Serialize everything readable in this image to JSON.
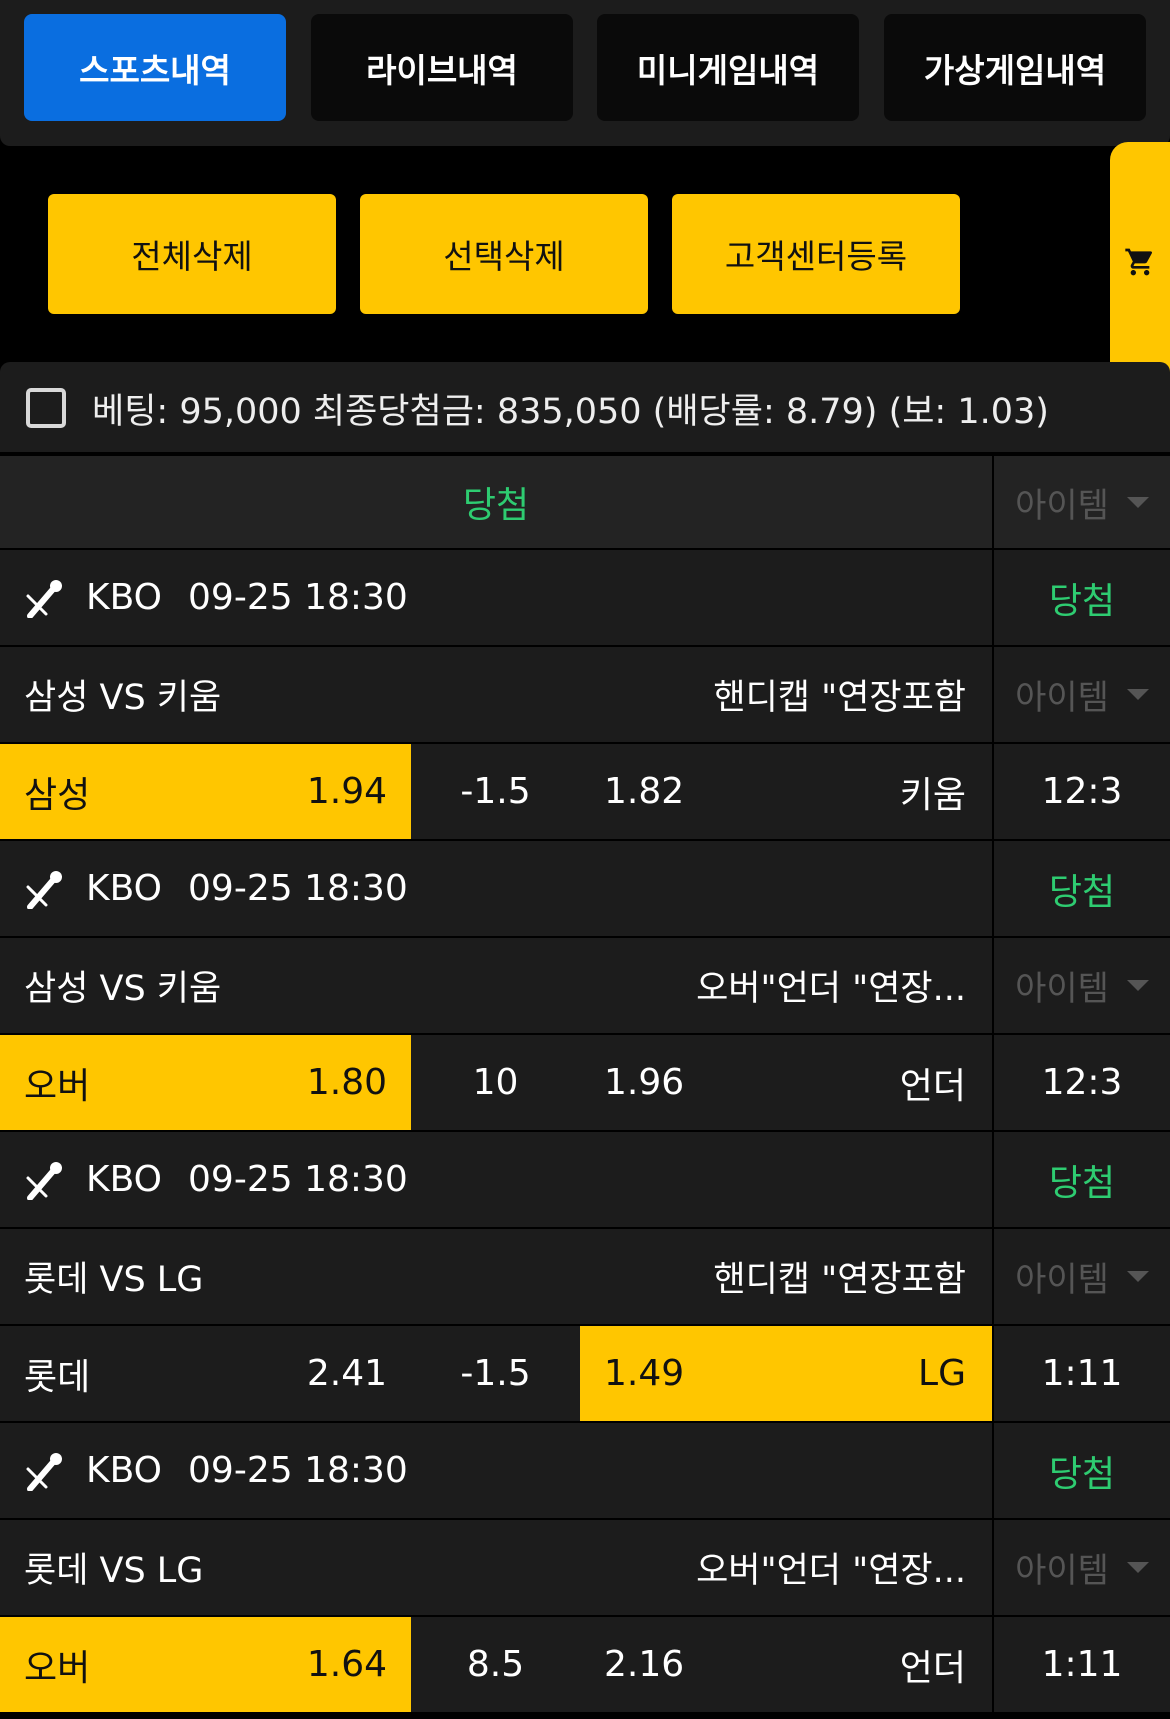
{
  "tabs": [
    {
      "label": "스포츠내역",
      "active": true
    },
    {
      "label": "라이브내역",
      "active": false
    },
    {
      "label": "미니게임내역",
      "active": false
    },
    {
      "label": "가상게임내역",
      "active": false
    }
  ],
  "actions": {
    "delete_all": "전체삭제",
    "delete_selected": "선택삭제",
    "register_support": "고객센터등록"
  },
  "cart_icon": "cart-icon",
  "summary": {
    "text": "베팅: 95,000 최종당첨금: 835,050 (배당률: 8.79) (보: 1.03)"
  },
  "header": {
    "result": "당첨",
    "item_label": "아이템"
  },
  "colors": {
    "accent_blue": "#0a6ee0",
    "accent_yellow": "#ffc600",
    "win_green": "#2ecc71"
  },
  "bets": [
    {
      "sport_icon": "baseball-icon",
      "league": "KBO",
      "datetime": "09-25 18:30",
      "result": "당첨",
      "match": "삼성 VS 키움",
      "bet_type": "핸디캡 \"연장포함",
      "item_label": "아이템",
      "home": "삼성",
      "home_odds": "1.94",
      "line": "-1.5",
      "away_odds": "1.82",
      "away": "키움",
      "selected": "home",
      "score": "12:3"
    },
    {
      "sport_icon": "baseball-icon",
      "league": "KBO",
      "datetime": "09-25 18:30",
      "result": "당첨",
      "match": "삼성 VS 키움",
      "bet_type": "오버\"언더 \"연장...",
      "item_label": "아이템",
      "home": "오버",
      "home_odds": "1.80",
      "line": "10",
      "away_odds": "1.96",
      "away": "언더",
      "selected": "home",
      "score": "12:3"
    },
    {
      "sport_icon": "baseball-icon",
      "league": "KBO",
      "datetime": "09-25 18:30",
      "result": "당첨",
      "match": "롯데 VS LG",
      "bet_type": "핸디캡 \"연장포함",
      "item_label": "아이템",
      "home": "롯데",
      "home_odds": "2.41",
      "line": "-1.5",
      "away_odds": "1.49",
      "away": "LG",
      "selected": "away",
      "score": "1:11"
    },
    {
      "sport_icon": "baseball-icon",
      "league": "KBO",
      "datetime": "09-25 18:30",
      "result": "당첨",
      "match": "롯데 VS LG",
      "bet_type": "오버\"언더 \"연장...",
      "item_label": "아이템",
      "home": "오버",
      "home_odds": "1.64",
      "line": "8.5",
      "away_odds": "2.16",
      "away": "언더",
      "selected": "home",
      "score": "1:11"
    }
  ]
}
